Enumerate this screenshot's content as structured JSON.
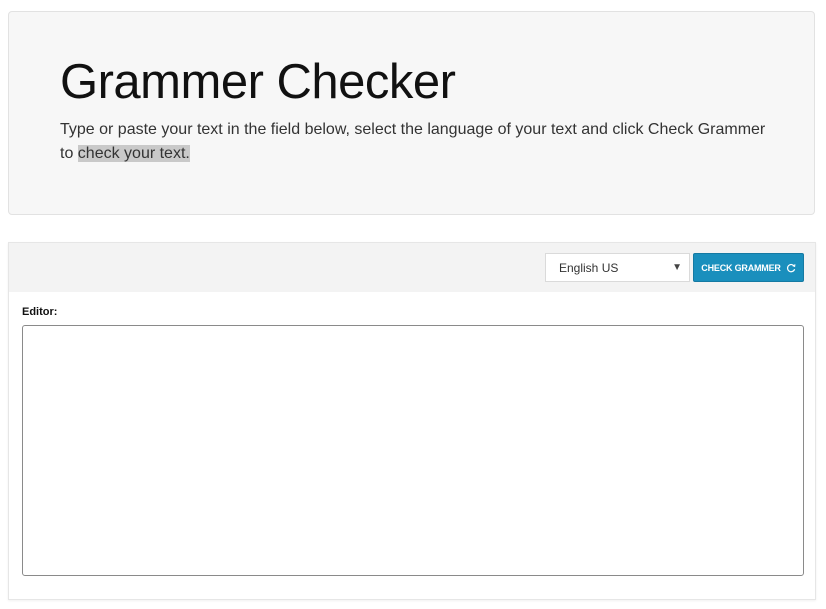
{
  "hero": {
    "title": "Grammer Checker",
    "description_prefix": "Type or paste your text in the field below, select the language of your text and click Check Grammer to ",
    "description_highlight": "check your text."
  },
  "toolbar": {
    "language_selected": "English US",
    "check_button_label": "CHECK GRAMMER",
    "check_button_icon": "refresh-icon",
    "dropdown_icon": "triangle-down-icon",
    "accent_color": "#1a8fbd"
  },
  "editor": {
    "label": "Editor:",
    "value": ""
  }
}
